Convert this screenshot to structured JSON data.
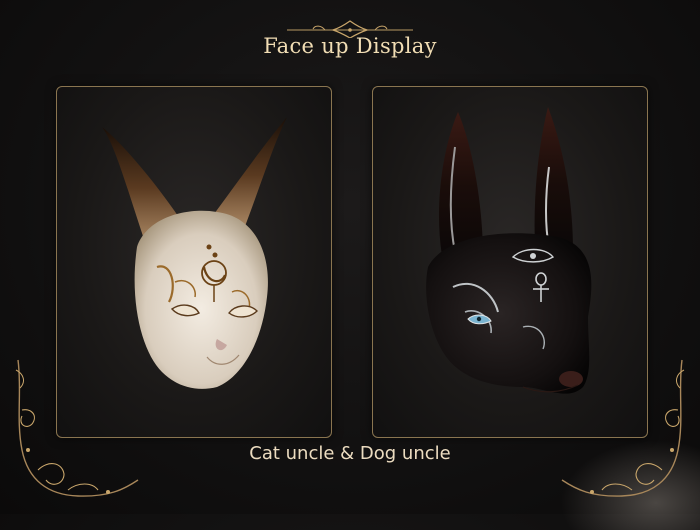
{
  "page": {
    "title": "Face up Display",
    "caption": "Cat uncle & Dog uncle"
  },
  "colors": {
    "accent_gold": "#c9a66b",
    "title_text": "#f1ddb4",
    "background": "#141212"
  },
  "panels": [
    {
      "subject": "cat-mask",
      "style": "ivory mask with gold moon face-up"
    },
    {
      "subject": "dog-mask",
      "style": "black mask with silver markings"
    }
  ]
}
